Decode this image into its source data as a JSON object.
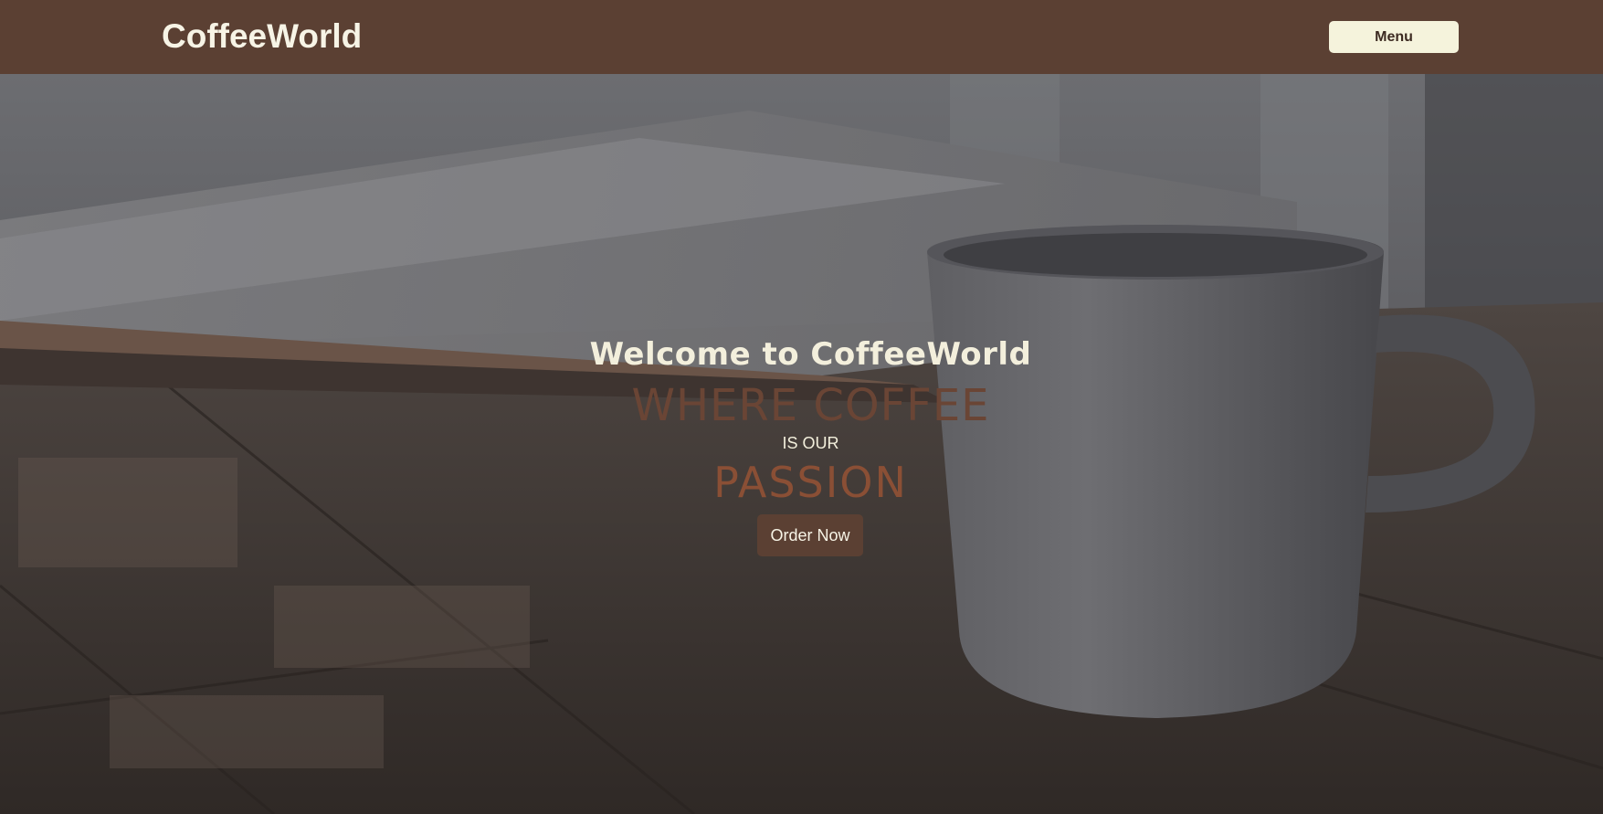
{
  "nav": {
    "brand": "CoffeeWorld",
    "menu_label": "Menu"
  },
  "hero": {
    "welcome": "Welcome to CoffeeWorld",
    "line1": "WHERE COFFEE",
    "line2": "IS OUR",
    "line3": "PASSION",
    "order_label": "Order Now"
  },
  "colors": {
    "navbar": "#5b4033",
    "menu_button": "#f5f3dc",
    "order_button": "#5b4033",
    "cream_text": "#f3efdc",
    "brown_text": "#6a4535"
  }
}
